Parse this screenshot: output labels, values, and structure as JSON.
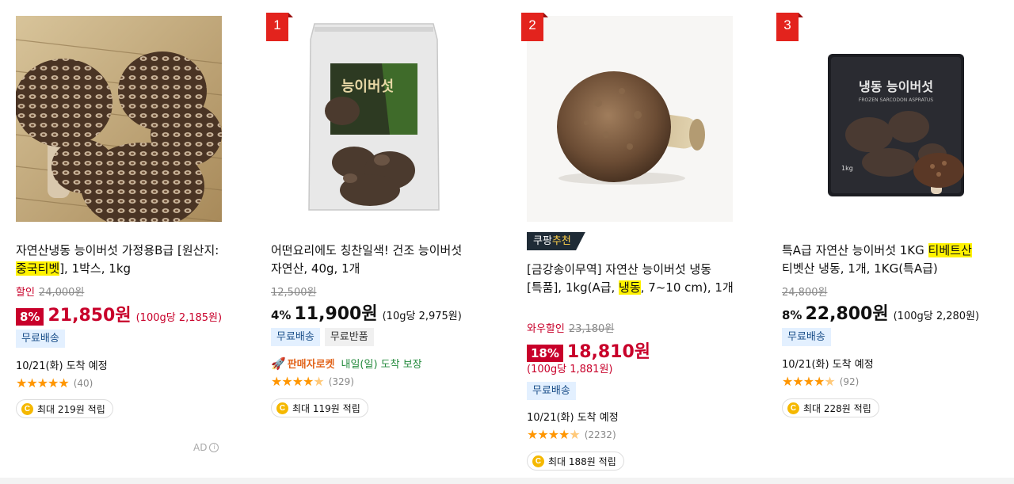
{
  "products": [
    {
      "title_pre": "자연산냉동 능이버섯 가정용B급 [원산지:",
      "title_highlight": "중국티벳",
      "title_post": "], 1박스, 1kg",
      "discount_label": "할인",
      "original_price": "24,000원",
      "discount_pct": "8%",
      "price": "21,850원",
      "unit_price": "(100g당 2,185원)",
      "tags": [
        "무료배송"
      ],
      "eta": "10/21(화) 도착 예정",
      "rating": 5.0,
      "review_count": "(40)",
      "reward": "최대 219원 적립",
      "ad_label": "AD"
    },
    {
      "rank": "1",
      "title": "어떤요리에도 칭찬일색! 건조 능이버섯 자연산, 40g, 1개",
      "original_price": "12,500원",
      "discount_pct": "4%",
      "price": "11,900원",
      "unit_price": "(10g당 2,975원)",
      "tags": [
        "무료배송",
        "무료반품"
      ],
      "seller_badge": "판매자로켓",
      "delivery_promise": "내일(일) 도착 보장",
      "rating": 4.5,
      "review_count": "(329)",
      "reward": "최대 119원 적립",
      "package_text": "능이버섯"
    },
    {
      "rank": "2",
      "rec_badge_pre": "쿠팡",
      "rec_badge_hl": "추천",
      "title_pre": "[금강송이무역] 자연산 능이버섯 냉동 [특품], 1kg(A급, ",
      "title_highlight": "냉동",
      "title_post": ", 7~10 cm), 1개",
      "discount_label": "와우할인",
      "original_price": "23,180원",
      "discount_pct": "18%",
      "price": "18,810원",
      "unit_price": "(100g당 1,881원)",
      "tags": [
        "무료배송"
      ],
      "eta": "10/21(화) 도착 예정",
      "rating": 4.5,
      "review_count": "(2232)",
      "reward": "최대 188원 적립"
    },
    {
      "rank": "3",
      "title_pre": "특A급 자연산 능이버섯 1KG ",
      "title_highlight": "티베트산",
      "title_post": " 티벳산 냉동, 1개, 1KG(특A급)",
      "original_price": "24,800원",
      "discount_pct": "8%",
      "price": "22,800원",
      "unit_price": "(100g당 2,280원)",
      "tags": [
        "무료배송"
      ],
      "eta": "10/21(화) 도착 예정",
      "rating": 4.5,
      "review_count": "(92)",
      "reward": "최대 228원 적립",
      "package_text": "냉동 능이버섯",
      "package_subtext": "FROZEN SARCODON ASPRATUS",
      "package_weight": "1kg"
    }
  ],
  "coin_symbol": "C",
  "info_symbol": "i",
  "colors": {
    "price_red": "#c8002a",
    "rank_red": "#e3231d",
    "star": "#ff9600",
    "tag_blue_bg": "#e3f0ff",
    "highlight": "#fff200"
  }
}
